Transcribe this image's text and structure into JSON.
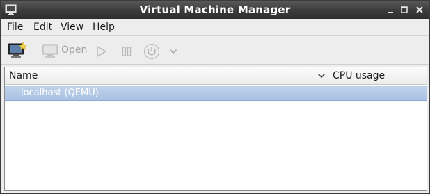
{
  "window": {
    "title": "Virtual Machine Manager"
  },
  "icons": {
    "app": "monitor-app-icon",
    "minimize": "minimize-icon",
    "maximize": "maximize-icon",
    "close": "close-icon",
    "new_vm": "new-vm-icon",
    "open": "monitor-icon",
    "run": "play-icon",
    "pause": "pause-icon",
    "shutdown": "power-icon",
    "shutdown_menu": "chevron-down-icon",
    "sort": "chevron-down-icon"
  },
  "menubar": {
    "items": [
      {
        "label": "File",
        "mnemonic": "F",
        "rest": "ile"
      },
      {
        "label": "Edit",
        "mnemonic": "E",
        "rest": "dit"
      },
      {
        "label": "View",
        "mnemonic": "V",
        "rest": "iew"
      },
      {
        "label": "Help",
        "mnemonic": "H",
        "rest": "elp"
      }
    ]
  },
  "toolbar": {
    "open_label": "Open"
  },
  "list": {
    "columns": [
      "Name",
      "CPU usage"
    ],
    "rows": [
      {
        "name": "localhost (QEMU)",
        "cpu_usage": ""
      }
    ]
  },
  "colors": {
    "titlebar": "#3b3b3b",
    "selection": "#a9c2e2",
    "window_bg": "#ededed"
  }
}
